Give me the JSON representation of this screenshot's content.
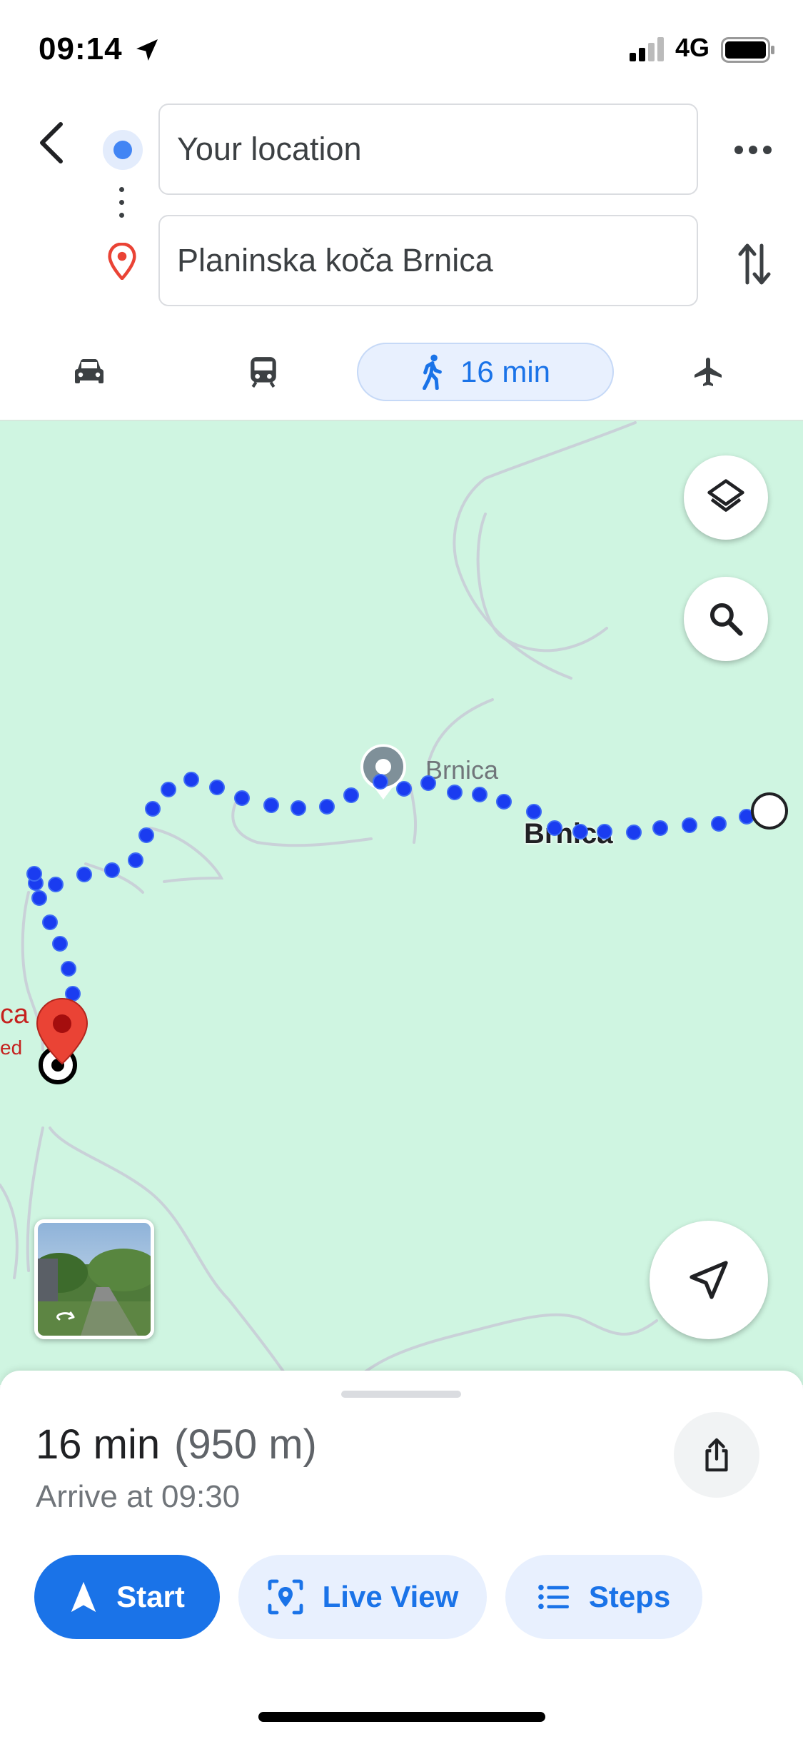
{
  "status_bar": {
    "time": "09:14",
    "network": "4G",
    "icons": [
      "location-arrow-icon",
      "signal-icon",
      "battery-icon"
    ]
  },
  "search": {
    "origin_value": "Your location",
    "destination_value": "Planinska koča Brnica"
  },
  "travel_modes": [
    {
      "mode": "drive",
      "icon": "car-icon",
      "label": ""
    },
    {
      "mode": "transit",
      "icon": "train-icon",
      "label": ""
    },
    {
      "mode": "walk",
      "icon": "walk-icon",
      "label": "16 min",
      "selected": true
    },
    {
      "mode": "flight",
      "icon": "airplane-icon",
      "label": ""
    }
  ],
  "map": {
    "poi_label": "Brnica",
    "place_label": "Brnica",
    "destination_label_partial": "ca",
    "destination_sublabel_partial": "ed",
    "route_color": "#1a3cf0",
    "background_color": "#cff5e1"
  },
  "summary": {
    "duration": "16 min",
    "distance": "(950 m)",
    "arrival": "Arrive at 09:30"
  },
  "actions": {
    "start_label": "Start",
    "live_view_label": "Live View",
    "steps_label": "Steps"
  },
  "colors": {
    "accent": "#1a73e8",
    "destination_red": "#ea4335"
  }
}
